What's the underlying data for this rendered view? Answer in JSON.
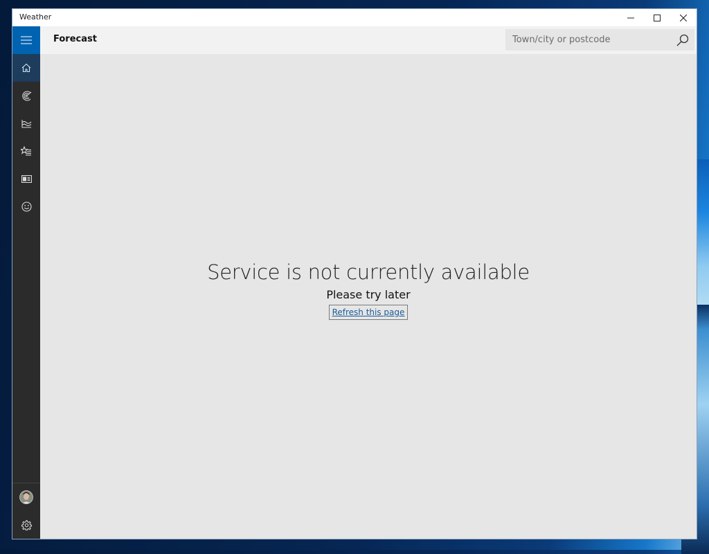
{
  "window": {
    "title": "Weather",
    "controls": {
      "minimize": "minimize",
      "maximize": "maximize",
      "close": "close"
    }
  },
  "sidebar": {
    "items": [
      {
        "name": "menu",
        "icon": "hamburger-icon"
      },
      {
        "name": "forecast",
        "icon": "home-icon",
        "active": true
      },
      {
        "name": "maps",
        "icon": "radar-icon"
      },
      {
        "name": "historical-weather",
        "icon": "chart-icon"
      },
      {
        "name": "places",
        "icon": "favorites-icon"
      },
      {
        "name": "news",
        "icon": "news-icon"
      },
      {
        "name": "feedback",
        "icon": "smiley-icon"
      }
    ],
    "bottom": [
      {
        "name": "account",
        "icon": "avatar"
      },
      {
        "name": "settings",
        "icon": "gear-icon"
      }
    ]
  },
  "header": {
    "title": "Forecast",
    "search_placeholder": "Town/city or postcode",
    "search_value": ""
  },
  "message": {
    "headline": "Service is not currently available",
    "subtext": "Please try later",
    "refresh_link": "Refresh this page"
  },
  "colors": {
    "accent": "#0063b1",
    "sidebar": "#2b2b2b",
    "link": "#1a5c99"
  }
}
